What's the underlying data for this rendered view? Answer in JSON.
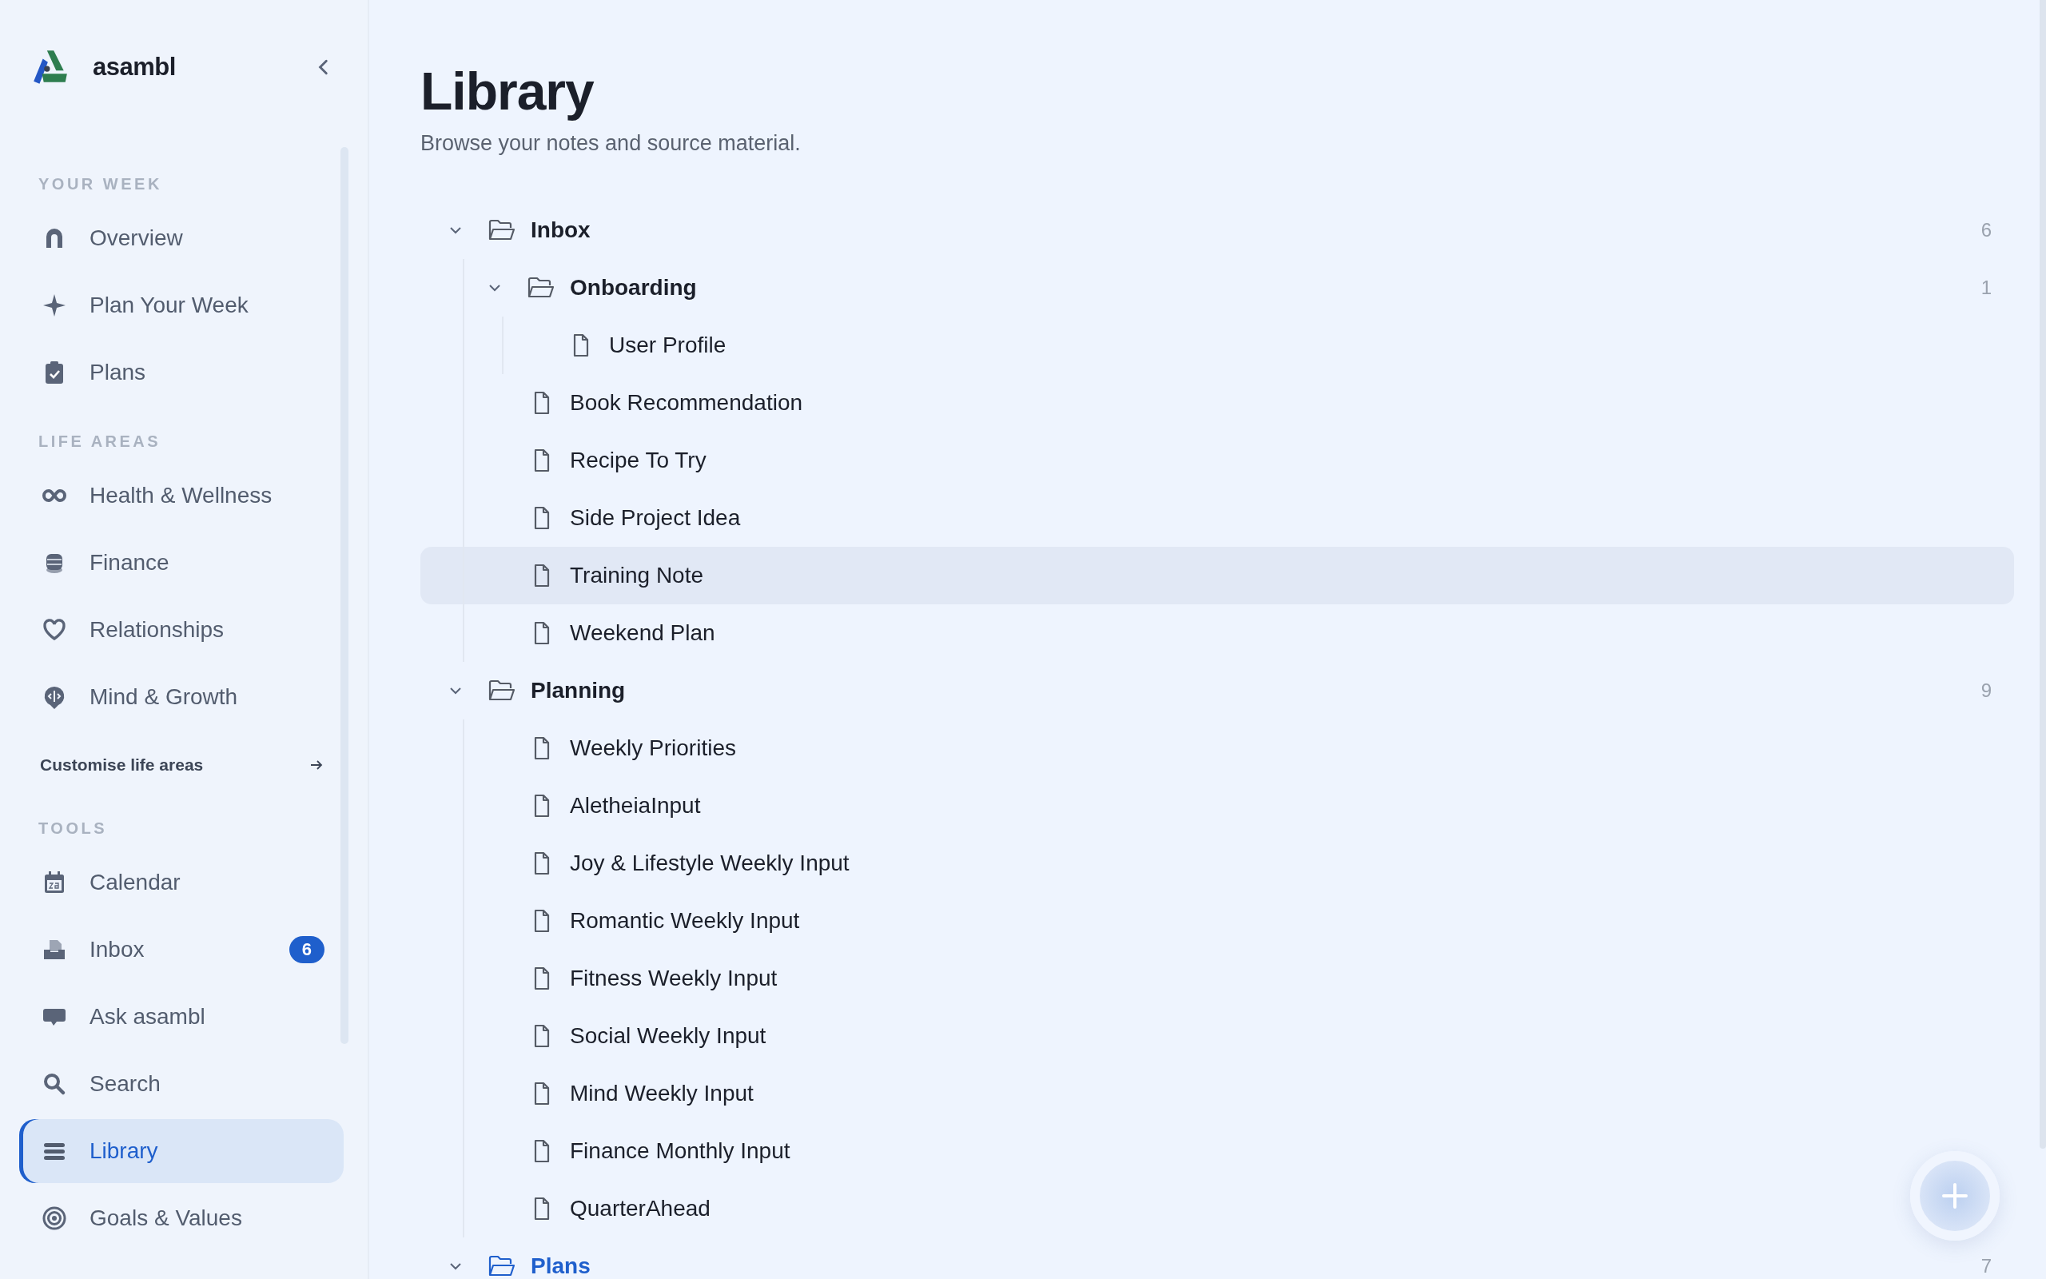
{
  "sidebar": {
    "brand": "asambl",
    "sections": [
      {
        "heading": "YOUR WEEK",
        "items": [
          {
            "label": "Overview",
            "selected": false
          },
          {
            "label": "Plan Your Week",
            "selected": false
          },
          {
            "label": "Plans",
            "selected": false
          }
        ]
      },
      {
        "heading": "LIFE AREAS",
        "items": [
          {
            "label": "Health & Wellness",
            "selected": false
          },
          {
            "label": "Finance",
            "selected": false
          },
          {
            "label": "Relationships",
            "selected": false
          },
          {
            "label": "Mind & Growth",
            "selected": false
          }
        ],
        "link": "Customise life areas"
      },
      {
        "heading": "TOOLS",
        "items": [
          {
            "label": "Calendar",
            "selected": false
          },
          {
            "label": "Inbox",
            "selected": false,
            "badge": "6"
          },
          {
            "label": "Ask asambl",
            "selected": false
          },
          {
            "label": "Search",
            "selected": false
          },
          {
            "label": "Library",
            "selected": true
          },
          {
            "label": "Goals & Values",
            "selected": false
          }
        ]
      }
    ]
  },
  "page": {
    "title": "Library",
    "subtitle": "Browse your notes and source material."
  },
  "tree": [
    {
      "kind": "folder",
      "label": "Inbox",
      "count": "6",
      "expanded": true,
      "selected": false,
      "hovered": false,
      "children": [
        {
          "kind": "folder",
          "label": "Onboarding",
          "count": "1",
          "expanded": true,
          "selected": false,
          "hovered": false,
          "children": [
            {
              "kind": "file",
              "label": "User Profile",
              "selected": false,
              "hovered": false
            }
          ]
        },
        {
          "kind": "file",
          "label": "Book Recommendation",
          "selected": false,
          "hovered": false
        },
        {
          "kind": "file",
          "label": "Recipe To Try",
          "selected": false,
          "hovered": false
        },
        {
          "kind": "file",
          "label": "Side Project Idea",
          "selected": false,
          "hovered": false
        },
        {
          "kind": "file",
          "label": "Training Note",
          "selected": false,
          "hovered": true
        },
        {
          "kind": "file",
          "label": "Weekend Plan",
          "selected": false,
          "hovered": false
        }
      ]
    },
    {
      "kind": "folder",
      "label": "Planning",
      "count": "9",
      "expanded": true,
      "selected": false,
      "hovered": false,
      "children": [
        {
          "kind": "file",
          "label": "Weekly Priorities",
          "selected": false,
          "hovered": false
        },
        {
          "kind": "file",
          "label": "AletheiaInput",
          "selected": false,
          "hovered": false
        },
        {
          "kind": "file",
          "label": "Joy & Lifestyle Weekly Input",
          "selected": false,
          "hovered": false
        },
        {
          "kind": "file",
          "label": "Romantic Weekly Input",
          "selected": false,
          "hovered": false
        },
        {
          "kind": "file",
          "label": "Fitness Weekly Input",
          "selected": false,
          "hovered": false
        },
        {
          "kind": "file",
          "label": "Social Weekly Input",
          "selected": false,
          "hovered": false
        },
        {
          "kind": "file",
          "label": "Mind Weekly Input",
          "selected": false,
          "hovered": false
        },
        {
          "kind": "file",
          "label": "Finance Monthly Input",
          "selected": false,
          "hovered": false
        },
        {
          "kind": "file",
          "label": "QuarterAhead",
          "selected": false,
          "hovered": false
        }
      ]
    },
    {
      "kind": "folder",
      "label": "Plans",
      "count": "7",
      "expanded": true,
      "selected": true,
      "hovered": false
    }
  ]
}
